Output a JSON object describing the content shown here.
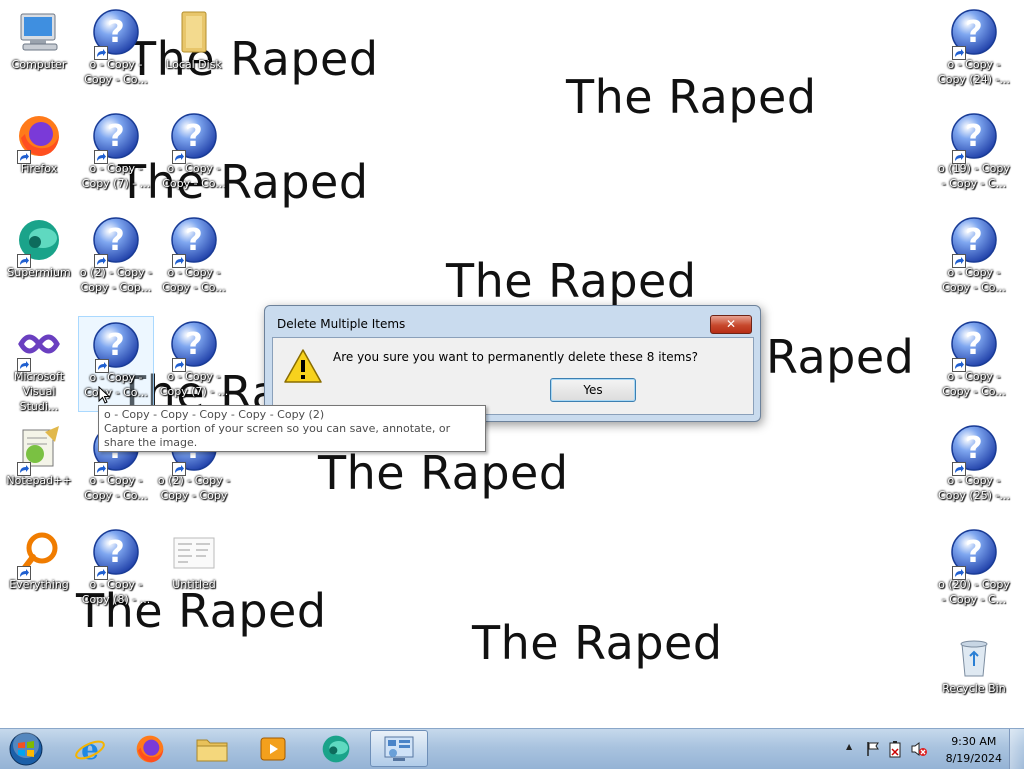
{
  "wallpaper": {
    "text": "The Raped",
    "partial_text_1": "The Ra",
    "partial_text_2": "Raped"
  },
  "desktop_icons": [
    {
      "label": "Computer",
      "icon": "computer-icon"
    },
    {
      "label": "o - Copy - Copy - Co...",
      "icon": "help-icon"
    },
    {
      "label": "Local Disk",
      "icon": "folder-icon"
    },
    {
      "label": "Firefox",
      "icon": "firefox-icon"
    },
    {
      "label": "o - Copy - Copy (7) - ...",
      "icon": "help-icon"
    },
    {
      "label": "o - Copy - Copy - Co...",
      "icon": "help-icon"
    },
    {
      "label": "Supermium",
      "icon": "supermium-icon"
    },
    {
      "label": "o (2) - Copy - Copy - Cop...",
      "icon": "help-icon"
    },
    {
      "label": "o - Copy - Copy - Co...",
      "icon": "help-icon"
    },
    {
      "label": "Microsoft Visual Studi...",
      "icon": "visual-studio-icon"
    },
    {
      "label": "o - Copy - Copy - Co...",
      "icon": "help-icon"
    },
    {
      "label": "o - Copy - Copy (7) - ...",
      "icon": "help-icon"
    },
    {
      "label": "Notepad++",
      "icon": "notepad-plus-plus-icon"
    },
    {
      "label": "o - Copy - Copy - Co...",
      "icon": "help-icon"
    },
    {
      "label": "o (2) - Copy - Copy - Copy",
      "icon": "help-icon"
    },
    {
      "label": "Everything",
      "icon": "everything-search-icon"
    },
    {
      "label": "o - Copy - Copy (8) - ...",
      "icon": "help-icon"
    },
    {
      "label": "Untitled",
      "icon": "document-icon"
    },
    {
      "label": "o - Copy - Copy (24) -...",
      "icon": "help-icon"
    },
    {
      "label": "o (19) - Copy - Copy - C...",
      "icon": "help-icon"
    },
    {
      "label": "o - Copy - Copy - Co...",
      "icon": "help-icon"
    },
    {
      "label": "o - Copy - Copy - Co...",
      "icon": "help-icon"
    },
    {
      "label": "o - Copy - Copy (25) -...",
      "icon": "help-icon"
    },
    {
      "label": "o (20) - Copy - Copy - C...",
      "icon": "help-icon"
    },
    {
      "label": "Recycle Bin",
      "icon": "recycle-bin-icon"
    }
  ],
  "dialog": {
    "title": "Delete Multiple Items",
    "close_label": "✕",
    "message": "Are you sure you want to permanently delete these 8 items?",
    "yes_label": "Yes"
  },
  "tooltip": {
    "line1": "o - Copy - Copy - Copy - Copy - Copy (2)",
    "line2": "Capture a portion of your screen so you can save, annotate, or share the image."
  },
  "taskbar": {
    "pinned": [
      "internet-explorer-icon",
      "firefox-icon",
      "file-explorer-icon",
      "media-player-icon",
      "supermium-icon",
      "control-panel-icon"
    ],
    "clock_time": "9:30 AM",
    "clock_date": "8/19/2024",
    "tray_chevron": "▲"
  },
  "colors": {
    "taskbar": "#a9c3df",
    "dialog_frame": "#c9dbee",
    "close_button": "#c7482c",
    "help_icon_blue": "#1f55c4"
  }
}
